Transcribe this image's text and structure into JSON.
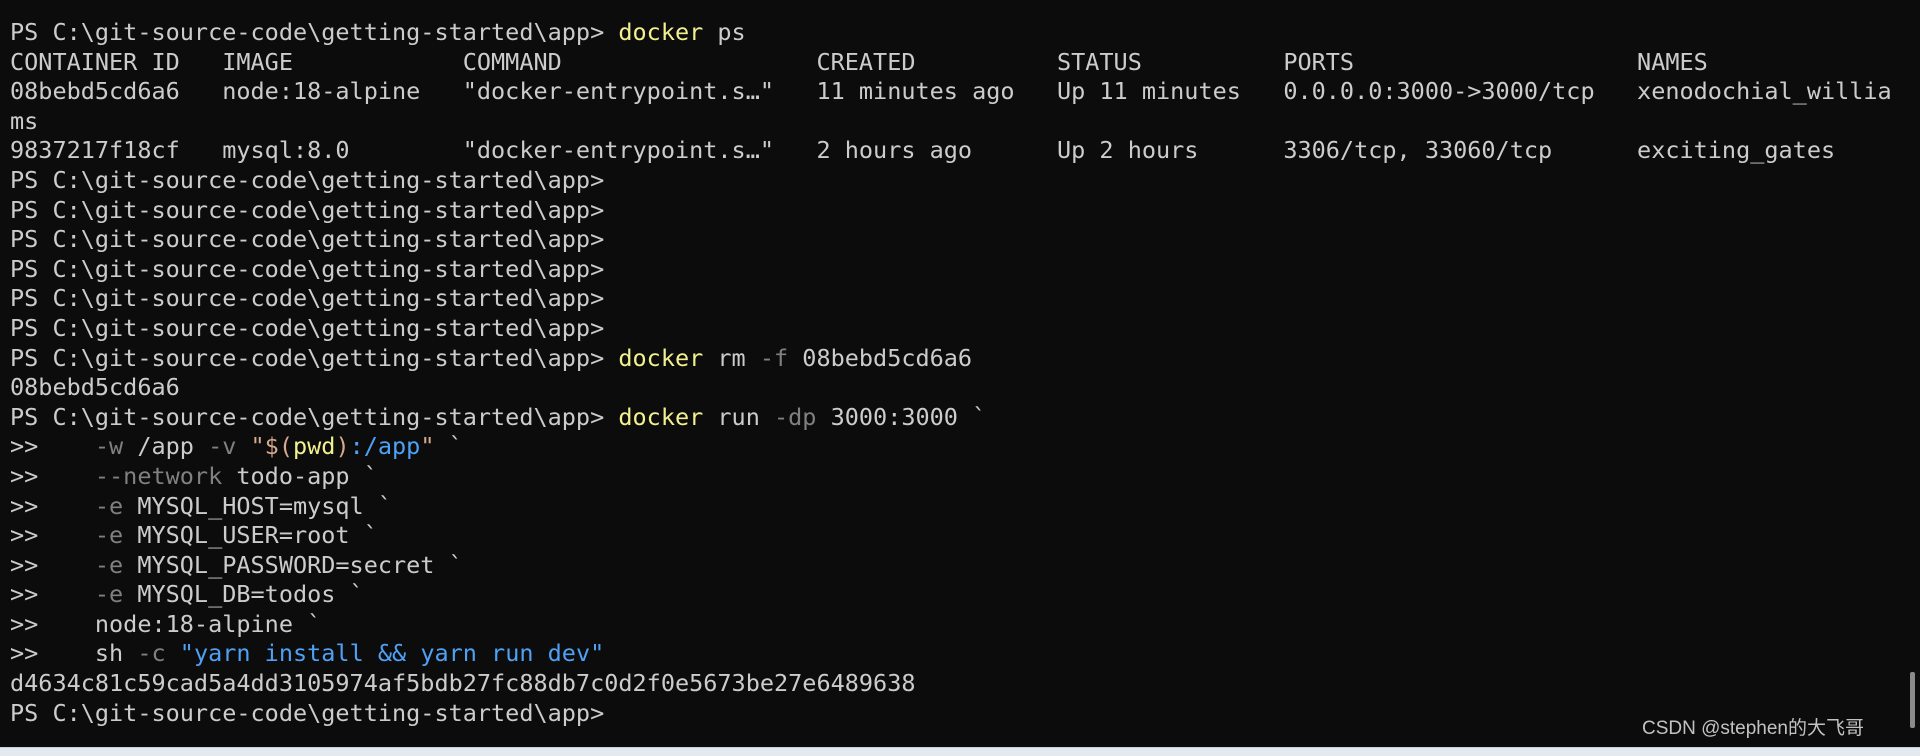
{
  "terminal": {
    "shell": "powershell",
    "background_color": "#0c0c0c",
    "foreground_color": "#cccccc",
    "prompt": "PS C:\\git-source-code\\getting-started\\app>",
    "continuation_prompt": ">>",
    "colors": {
      "command": "#f3f08e",
      "parameter": "#808080",
      "string": "#4ea1f5",
      "operator": "#d7a98c",
      "variable": "#f3f08e",
      "default": "#cccccc"
    }
  },
  "lines": [
    {
      "id": "l01",
      "segments": [
        {
          "text": "PS C:\\git-source-code\\getting-started\\app> ",
          "cls": "c-default"
        },
        {
          "text": "docker",
          "cls": "c-command"
        },
        {
          "text": " ps",
          "cls": "c-default"
        }
      ]
    },
    {
      "id": "l02",
      "segments": [
        {
          "text": "CONTAINER ID   IMAGE            COMMAND                  CREATED          STATUS          PORTS                    NAMES",
          "cls": "c-default"
        }
      ]
    },
    {
      "id": "l03",
      "segments": [
        {
          "text": "08bebd5cd6a6   node:18-alpine   \"docker-entrypoint.s…\"   11 minutes ago   Up 11 minutes   0.0.0.0:3000->3000/tcp   xenodochial_willia",
          "cls": "c-default"
        }
      ]
    },
    {
      "id": "l04",
      "segments": [
        {
          "text": "ms",
          "cls": "c-default"
        }
      ]
    },
    {
      "id": "l05",
      "segments": [
        {
          "text": "9837217f18cf   mysql:8.0        \"docker-entrypoint.s…\"   2 hours ago      Up 2 hours      3306/tcp, 33060/tcp      exciting_gates",
          "cls": "c-default"
        }
      ]
    },
    {
      "id": "l06",
      "segments": [
        {
          "text": "PS C:\\git-source-code\\getting-started\\app>",
          "cls": "c-default"
        }
      ]
    },
    {
      "id": "l07",
      "segments": [
        {
          "text": "PS C:\\git-source-code\\getting-started\\app>",
          "cls": "c-default"
        }
      ]
    },
    {
      "id": "l08",
      "segments": [
        {
          "text": "PS C:\\git-source-code\\getting-started\\app>",
          "cls": "c-default"
        }
      ]
    },
    {
      "id": "l09",
      "segments": [
        {
          "text": "PS C:\\git-source-code\\getting-started\\app>",
          "cls": "c-default"
        }
      ]
    },
    {
      "id": "l10",
      "segments": [
        {
          "text": "PS C:\\git-source-code\\getting-started\\app>",
          "cls": "c-default"
        }
      ]
    },
    {
      "id": "l11",
      "segments": [
        {
          "text": "PS C:\\git-source-code\\getting-started\\app>",
          "cls": "c-default"
        }
      ]
    },
    {
      "id": "l12",
      "segments": [
        {
          "text": "PS C:\\git-source-code\\getting-started\\app> ",
          "cls": "c-default"
        },
        {
          "text": "docker",
          "cls": "c-command"
        },
        {
          "text": " rm ",
          "cls": "c-default"
        },
        {
          "text": "-f",
          "cls": "c-param"
        },
        {
          "text": " 08bebd5cd6a6",
          "cls": "c-default"
        }
      ]
    },
    {
      "id": "l13",
      "segments": [
        {
          "text": "08bebd5cd6a6",
          "cls": "c-default"
        }
      ]
    },
    {
      "id": "l14",
      "segments": [
        {
          "text": "PS C:\\git-source-code\\getting-started\\app> ",
          "cls": "c-default"
        },
        {
          "text": "docker",
          "cls": "c-command"
        },
        {
          "text": " run ",
          "cls": "c-default"
        },
        {
          "text": "-dp",
          "cls": "c-param"
        },
        {
          "text": " 3000:3000 `",
          "cls": "c-default"
        }
      ]
    },
    {
      "id": "l15",
      "segments": [
        {
          "text": ">>    ",
          "cls": "c-continue"
        },
        {
          "text": "-w",
          "cls": "c-param"
        },
        {
          "text": " /app ",
          "cls": "c-default"
        },
        {
          "text": "-v",
          "cls": "c-param"
        },
        {
          "text": " ",
          "cls": "c-default"
        },
        {
          "text": "\"$(",
          "cls": "c-operator"
        },
        {
          "text": "pwd",
          "cls": "c-var"
        },
        {
          "text": ")",
          "cls": "c-operator"
        },
        {
          "text": ":/app",
          "cls": "c-string"
        },
        {
          "text": "\"",
          "cls": "c-operator"
        },
        {
          "text": " `",
          "cls": "c-default"
        }
      ]
    },
    {
      "id": "l16",
      "segments": [
        {
          "text": ">>    ",
          "cls": "c-continue"
        },
        {
          "text": "--network",
          "cls": "c-param"
        },
        {
          "text": " todo-app `",
          "cls": "c-default"
        }
      ]
    },
    {
      "id": "l17",
      "segments": [
        {
          "text": ">>    ",
          "cls": "c-continue"
        },
        {
          "text": "-e",
          "cls": "c-param"
        },
        {
          "text": " MYSQL_HOST=mysql `",
          "cls": "c-default"
        }
      ]
    },
    {
      "id": "l18",
      "segments": [
        {
          "text": ">>    ",
          "cls": "c-continue"
        },
        {
          "text": "-e",
          "cls": "c-param"
        },
        {
          "text": " MYSQL_USER=root `",
          "cls": "c-default"
        }
      ]
    },
    {
      "id": "l19",
      "segments": [
        {
          "text": ">>    ",
          "cls": "c-continue"
        },
        {
          "text": "-e",
          "cls": "c-param"
        },
        {
          "text": " MYSQL_PASSWORD=secret `",
          "cls": "c-default"
        }
      ]
    },
    {
      "id": "l20",
      "segments": [
        {
          "text": ">>    ",
          "cls": "c-continue"
        },
        {
          "text": "-e",
          "cls": "c-param"
        },
        {
          "text": " MYSQL_DB=todos `",
          "cls": "c-default"
        }
      ]
    },
    {
      "id": "l21",
      "segments": [
        {
          "text": ">>    node:18-alpine `",
          "cls": "c-default"
        }
      ]
    },
    {
      "id": "l22",
      "segments": [
        {
          "text": ">>    sh ",
          "cls": "c-default"
        },
        {
          "text": "-c",
          "cls": "c-param"
        },
        {
          "text": " ",
          "cls": "c-default"
        },
        {
          "text": "\"yarn install && yarn run dev\"",
          "cls": "c-string"
        }
      ]
    },
    {
      "id": "l23",
      "segments": [
        {
          "text": "d4634c81c59cad5a4dd3105974af5bdb27fc88db7c0d2f0e5673be27e6489638",
          "cls": "c-default"
        }
      ]
    },
    {
      "id": "l24",
      "segments": [
        {
          "text": "PS C:\\git-source-code\\getting-started\\app>",
          "cls": "c-default"
        }
      ]
    }
  ],
  "watermark": {
    "text": "CSDN @stephen的大飞哥"
  },
  "scrollbar": {
    "orientation": "vertical",
    "position": "right"
  }
}
